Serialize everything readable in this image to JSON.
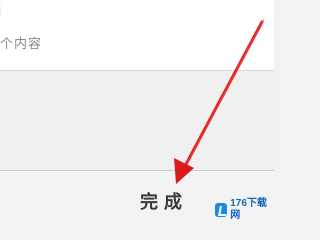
{
  "top_card": {
    "title_fragment": "i",
    "subtitle_fragment": "个内容"
  },
  "footer": {
    "done_label": "完成"
  },
  "annotation": {
    "arrow_color": "#e02020"
  },
  "watermark": {
    "text": "176下载网",
    "logo_icon": "176-logo-icon",
    "color": "#1565c0"
  }
}
